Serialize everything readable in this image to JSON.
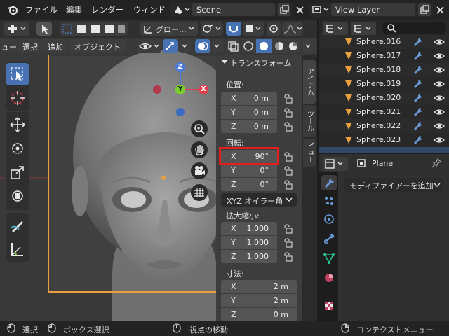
{
  "menu": {
    "file": "ファイル",
    "edit": "編集",
    "render": "レンダー",
    "window": "ウィンド"
  },
  "scene": {
    "name": "Scene"
  },
  "view_layer": {
    "name": "View Layer"
  },
  "viewport_header": {
    "transform_orientation": "グロー...",
    "select_mode": "選択",
    "add": "追加",
    "object": "オブジェクト",
    "view_short": "ュー"
  },
  "npanel": {
    "section_title": "トランスフォーム",
    "location_label": "位置:",
    "location": [
      {
        "axis": "X",
        "value": "0 m"
      },
      {
        "axis": "Y",
        "value": "0 m"
      },
      {
        "axis": "Z",
        "value": "0 m"
      }
    ],
    "rotation_label": "回転:",
    "rotation": [
      {
        "axis": "X",
        "value": "90°"
      },
      {
        "axis": "Y",
        "value": "0°"
      },
      {
        "axis": "Z",
        "value": "0°"
      }
    ],
    "rotation_mode": "XYZ オイラー角",
    "scale_label": "拡大縮小:",
    "scale": [
      {
        "axis": "X",
        "value": "1.000"
      },
      {
        "axis": "Y",
        "value": "1.000"
      },
      {
        "axis": "Z",
        "value": "1.000"
      }
    ],
    "dimensions_label": "寸法:",
    "dimensions": [
      {
        "axis": "X",
        "value": "2 m"
      },
      {
        "axis": "Y",
        "value": "2 m"
      },
      {
        "axis": "Z",
        "value": "0 m"
      }
    ],
    "tabs": [
      "アイテム",
      "ツール",
      "ビュー"
    ],
    "highlight_color": "#e02020"
  },
  "outliner": {
    "rows": [
      "Sphere.016",
      "Sphere.017",
      "Sphere.018",
      "Sphere.019",
      "Sphere.020",
      "Sphere.021",
      "Sphere.022",
      "Sphere.023"
    ]
  },
  "properties": {
    "object_name": "Plane",
    "add_modifier": "モディファイアーを追加"
  },
  "gizmo": {
    "z": "Z",
    "y": "Y",
    "x": "X"
  },
  "status": {
    "select": "選択",
    "box_select": "ボックス選択",
    "move_view": "視点の移動",
    "context_menu": "コンテクストメニュー"
  },
  "colors": {
    "accent": "#4772b3",
    "orange": "#e8a040",
    "modifier_icon": "#6a9ad8",
    "mesh_green": "#27c48c"
  }
}
